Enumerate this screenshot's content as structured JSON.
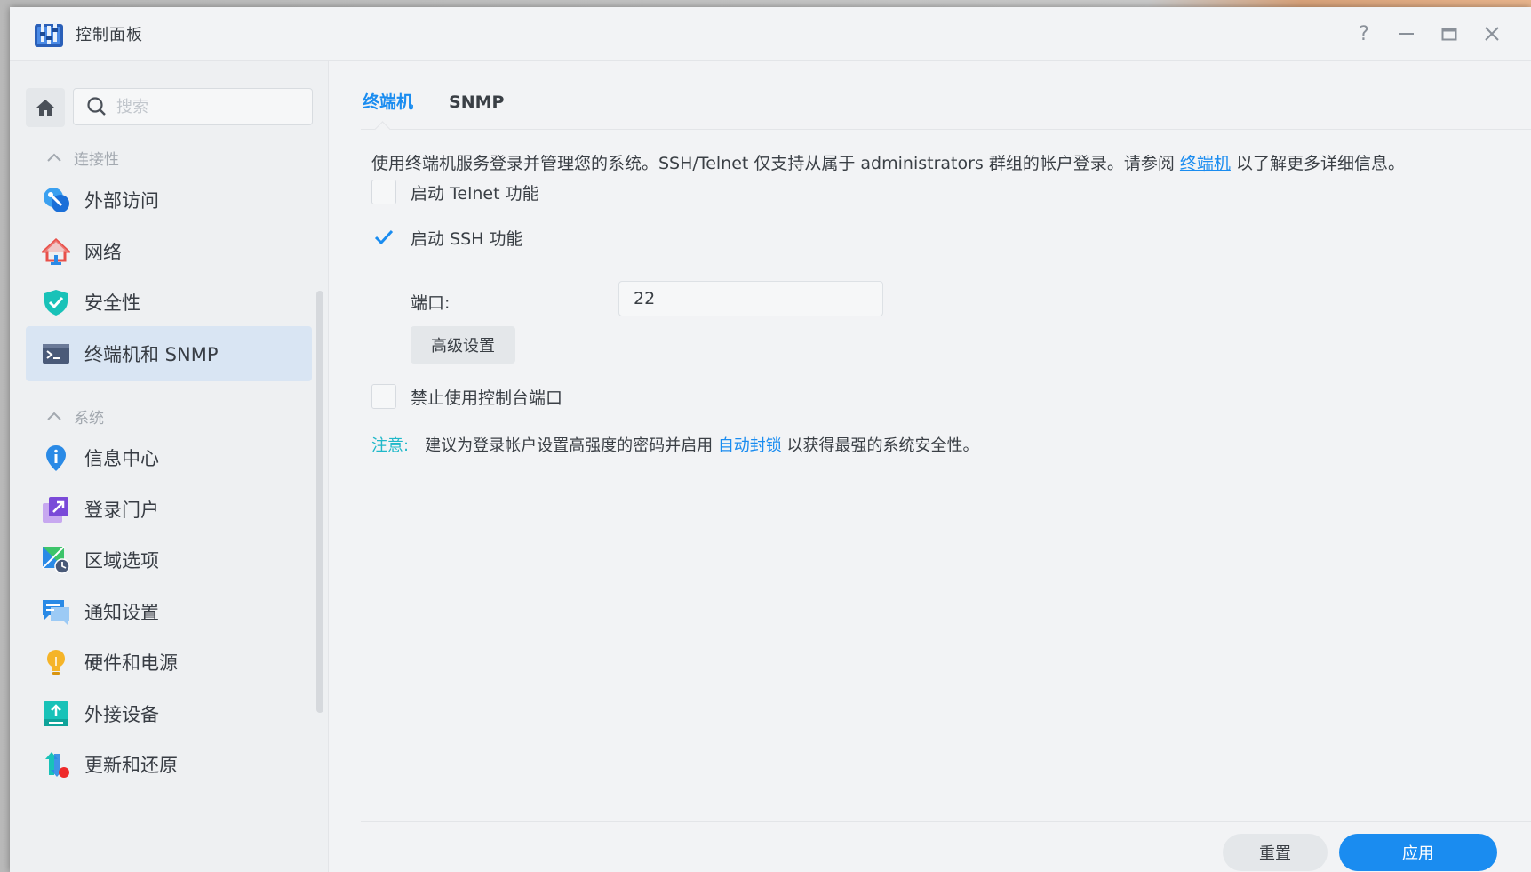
{
  "window": {
    "title": "控制面板",
    "controls": {
      "help": "?",
      "minimize": "—",
      "maximize": "▭",
      "close": "✕"
    }
  },
  "sidebar": {
    "search_placeholder": "搜索",
    "sections": [
      {
        "label": "连接性",
        "items": [
          {
            "label": "外部访问",
            "icon": "external-access-icon"
          },
          {
            "label": "网络",
            "icon": "network-icon"
          },
          {
            "label": "安全性",
            "icon": "security-shield-icon"
          },
          {
            "label": "终端机和 SNMP",
            "icon": "terminal-icon",
            "active": true
          }
        ]
      },
      {
        "label": "系统",
        "items": [
          {
            "label": "信息中心",
            "icon": "info-center-icon"
          },
          {
            "label": "登录门户",
            "icon": "login-portal-icon"
          },
          {
            "label": "区域选项",
            "icon": "regional-options-icon"
          },
          {
            "label": "通知设置",
            "icon": "notification-icon"
          },
          {
            "label": "硬件和电源",
            "icon": "hardware-power-icon"
          },
          {
            "label": "外接设备",
            "icon": "external-devices-icon"
          },
          {
            "label": "更新和还原",
            "icon": "update-restore-icon"
          }
        ]
      }
    ]
  },
  "main": {
    "tabs": [
      {
        "label": "终端机",
        "active": true
      },
      {
        "label": "SNMP",
        "active": false
      }
    ],
    "description": {
      "before": "使用终端机服务登录并管理您的系统。SSH/Telnet 仅支持从属于 administrators 群组的帐户登录。请参阅 ",
      "link": "终端机",
      "after": " 以了解更多详细信息。"
    },
    "telnet_label": "启动 Telnet 功能",
    "telnet_checked": false,
    "ssh_label": "启动 SSH 功能",
    "ssh_checked": true,
    "port_label": "端口:",
    "port_value": "22",
    "advanced_button": "高级设置",
    "console_label": "禁止使用控制台端口",
    "console_checked": false,
    "note": {
      "label": "注意:",
      "before": "建议为登录帐户设置高强度的密码并启用 ",
      "link": "自动封锁",
      "after": " 以获得最强的系统安全性。"
    },
    "reset_button": "重置",
    "apply_button": "应用"
  },
  "colors": {
    "accent": "#1a8cf0",
    "note": "#1fb8c9",
    "active_nav_bg": "#d9e5f3"
  }
}
